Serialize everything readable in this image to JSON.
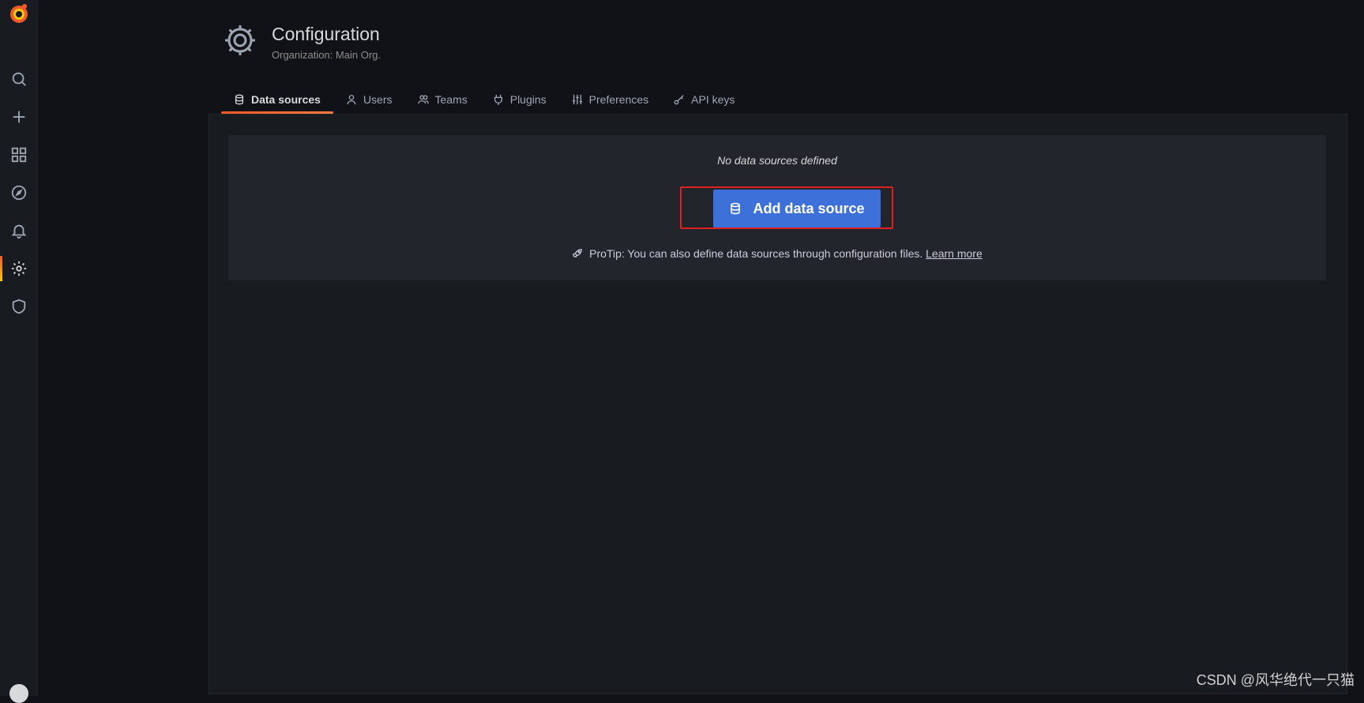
{
  "sidebar": {
    "items": [
      {
        "name": "search"
      },
      {
        "name": "create"
      },
      {
        "name": "dashboards"
      },
      {
        "name": "explore"
      },
      {
        "name": "alerting"
      },
      {
        "name": "configuration",
        "active": true
      },
      {
        "name": "server-admin"
      }
    ]
  },
  "header": {
    "title": "Configuration",
    "subtitle": "Organization: Main Org."
  },
  "tabs": [
    {
      "label": "Data sources",
      "icon": "database-icon",
      "active": true
    },
    {
      "label": "Users",
      "icon": "user-icon"
    },
    {
      "label": "Teams",
      "icon": "users-icon"
    },
    {
      "label": "Plugins",
      "icon": "plug-icon"
    },
    {
      "label": "Preferences",
      "icon": "sliders-icon"
    },
    {
      "label": "API keys",
      "icon": "key-icon"
    }
  ],
  "empty_state": {
    "message": "No data sources defined",
    "button_label": "Add data source",
    "protip_text": "ProTip: You can also define data sources through configuration files.",
    "learn_more": "Learn more"
  },
  "watermark": "CSDN @风华绝代一只猫",
  "colors": {
    "background": "#111217",
    "panel": "#22252b",
    "primary_button": "#3d71d9",
    "accent": "#f05a28",
    "highlight_border": "#e02020"
  }
}
